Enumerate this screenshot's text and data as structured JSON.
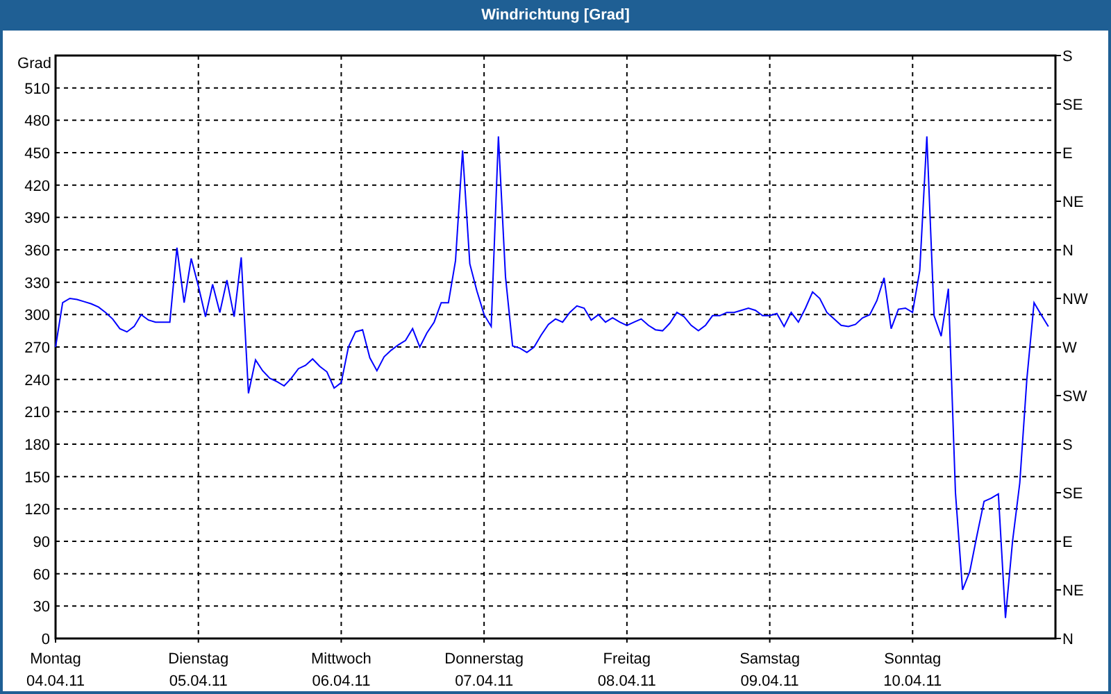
{
  "window": {
    "title": "Windrichtung [Grad]"
  },
  "chart": {
    "chart_data": {
      "type": "line",
      "ylabel": "Grad",
      "ylim": [
        0,
        540
      ],
      "grid": true,
      "categories": [
        "Montag",
        null,
        null,
        null,
        null,
        null,
        null,
        null,
        null,
        null,
        null,
        null,
        null,
        null,
        null,
        null,
        null,
        null,
        null,
        null,
        "Dienstag",
        null,
        null,
        null,
        null,
        null,
        null,
        null,
        null,
        null,
        null,
        null,
        null,
        null,
        null,
        null,
        null,
        null,
        null,
        null,
        "Mittwoch",
        null,
        null,
        null,
        null,
        null,
        null,
        null,
        null,
        null,
        null,
        null,
        null,
        null,
        null,
        null,
        null,
        null,
        null,
        null,
        "Donnerstag",
        null,
        null,
        null,
        null,
        null,
        null,
        null,
        null,
        null,
        null,
        null,
        null,
        null,
        null,
        null,
        null,
        null,
        null,
        null,
        "Freitag",
        null,
        null,
        null,
        null,
        null,
        null,
        null,
        null,
        null,
        null,
        null,
        null,
        null,
        null,
        null,
        null,
        null,
        null,
        null,
        "Samstag",
        null,
        null,
        null,
        null,
        null,
        null,
        null,
        null,
        null,
        null,
        null,
        null,
        null,
        null,
        null,
        null,
        null,
        null,
        null,
        "Sonntag",
        null,
        null,
        null,
        null,
        null,
        null,
        null,
        null,
        null,
        null,
        null,
        null,
        null,
        null,
        null,
        null,
        null,
        null,
        null,
        null
      ],
      "series": [
        {
          "color": "#0000ff",
          "values": [
            270,
            311,
            315,
            314,
            312,
            310,
            307,
            302,
            296,
            287,
            284,
            289,
            300,
            295,
            293,
            293,
            293,
            362,
            311,
            352,
            326,
            298,
            328,
            302,
            332,
            298,
            353,
            227,
            258,
            248,
            241,
            238,
            234,
            241,
            250,
            253,
            259,
            252,
            247,
            232,
            237,
            270,
            284,
            286,
            260,
            248,
            261,
            267,
            272,
            276,
            287,
            270,
            283,
            293,
            311,
            311,
            350,
            452,
            347,
            322,
            300,
            289,
            465,
            335,
            271,
            269,
            265,
            270,
            281,
            291,
            296,
            293,
            302,
            308,
            306,
            295,
            300,
            293,
            297,
            293,
            290,
            293,
            296,
            290,
            286,
            285,
            292,
            302,
            298,
            290,
            285,
            290,
            299,
            299,
            302,
            302,
            304,
            306,
            304,
            299,
            299,
            301,
            289,
            302,
            293,
            306,
            321,
            315,
            302,
            296,
            290,
            289,
            291,
            297,
            300,
            313,
            334,
            287,
            305,
            306,
            302,
            341,
            465,
            299,
            280,
            324,
            135,
            45,
            62,
            95,
            127,
            130,
            134,
            19,
            90,
            144,
            240,
            311,
            300,
            289,
            null
          ]
        }
      ],
      "yticks": [
        0,
        30,
        60,
        90,
        120,
        150,
        180,
        210,
        240,
        270,
        300,
        330,
        360,
        390,
        420,
        450,
        480,
        510
      ]
    },
    "x_dates": [
      "04.04.11",
      "05.04.11",
      "06.04.11",
      "07.04.11",
      "08.04.11",
      "09.04.11",
      "10.04.11"
    ],
    "right_axis_labels": [
      "S",
      "SE",
      "E",
      "NE",
      "N",
      "NW",
      "W",
      "SW",
      "S",
      "SE",
      "E",
      "NE",
      "N"
    ]
  }
}
